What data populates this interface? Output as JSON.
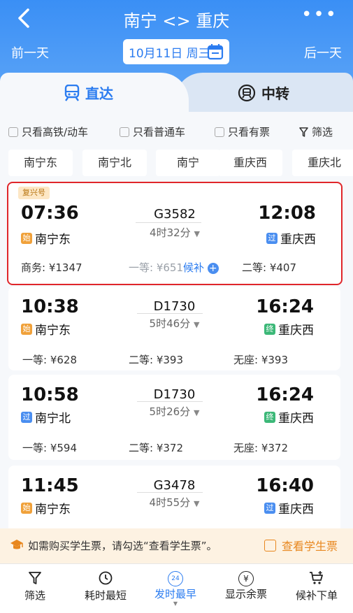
{
  "header": {
    "title": "南宁 <> 重庆",
    "more": "•••",
    "prev_day": "前一天",
    "next_day": "后一天",
    "date": "10月11日 周三"
  },
  "tabs": [
    {
      "label": "直达",
      "active": true
    },
    {
      "label": "中转",
      "active": false
    }
  ],
  "filters": [
    "只看高铁/动车",
    "只看普通车",
    "只看有票",
    "筛选"
  ],
  "stations": [
    "南宁东",
    "南宁北",
    "南宁",
    "重庆西",
    "重庆北"
  ],
  "trains": [
    {
      "badge": "复兴号",
      "dep_time": "07:36",
      "dep_tag": "始",
      "dep_station": "南宁东",
      "train_no": "G3582",
      "duration": "4时32分",
      "arr_time": "12:08",
      "arr_tag": "过",
      "arr_station": "重庆西",
      "prices": [
        "商务: ¥1347",
        "一等: ¥651",
        "二等: ¥407"
      ],
      "houbu": "候补"
    },
    {
      "dep_time": "10:38",
      "dep_tag": "始",
      "dep_station": "南宁东",
      "train_no": "D1730",
      "duration": "5时46分",
      "arr_time": "16:24",
      "arr_tag": "终",
      "arr_station": "重庆西",
      "prices": [
        "一等: ¥628",
        "二等: ¥393",
        "无座: ¥393"
      ]
    },
    {
      "dep_time": "10:58",
      "dep_tag": "过",
      "dep_station": "南宁北",
      "train_no": "D1730",
      "duration": "5时26分",
      "arr_time": "16:24",
      "arr_tag": "终",
      "arr_station": "重庆西",
      "prices": [
        "一等: ¥594",
        "二等: ¥372",
        "无座: ¥372"
      ]
    },
    {
      "dep_time": "11:45",
      "dep_tag": "始",
      "dep_station": "南宁东",
      "train_no": "G3478",
      "duration": "4时55分",
      "arr_time": "16:40",
      "arr_tag": "过",
      "arr_station": "重庆西"
    }
  ],
  "notice": {
    "text": "如需购买学生票，请勾选“查看学生票”。",
    "checkbox_label": "查看学生票"
  },
  "bottom_nav": [
    {
      "label": "筛选",
      "icon": "filter-icon"
    },
    {
      "label": "耗时最短",
      "icon": "clock-icon"
    },
    {
      "label": "发时最早",
      "icon": "24h-icon",
      "icon_text": "24",
      "active": true
    },
    {
      "label": "显示余票",
      "icon": "yen-icon",
      "icon_text": "¥"
    },
    {
      "label": "候补下单",
      "icon": "cart-plus-icon"
    }
  ],
  "colors": {
    "accent": "#2b7cf0",
    "highlight_border": "#e0262a",
    "notice_bg": "#fdf2e2",
    "student_orange": "#e8871e"
  }
}
